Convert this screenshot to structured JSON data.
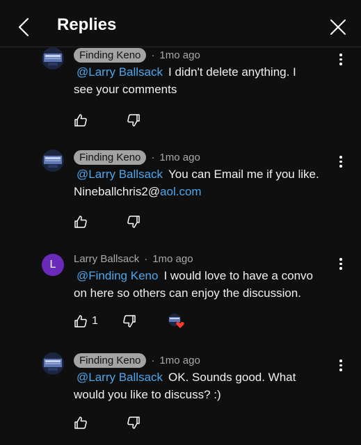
{
  "header": {
    "title": "Replies"
  },
  "comments": [
    {
      "author": "Finding Keno",
      "author_highlight": true,
      "time": "1mo ago",
      "mention": "@Larry Ballsack",
      "text_line1": "I didn't delete anything. I",
      "text_line2": "see your comments",
      "likes": ""
    },
    {
      "author": "Finding Keno",
      "author_highlight": true,
      "time": "1mo ago",
      "mention": "@Larry Ballsack",
      "text_line1": "You can Email me if you like.",
      "email_user": "Nineballchris2@",
      "email_domain": "aol.com",
      "likes": ""
    },
    {
      "author": "Larry Ballsack",
      "author_highlight": false,
      "avatar_letter": "L",
      "time": "1mo ago",
      "mention": "@Finding Keno",
      "text_line1": "I would love to have a convo",
      "text_line2": "on here so others can enjoy the discussion.",
      "likes": "1",
      "creator_heart": true
    },
    {
      "author": "Finding Keno",
      "author_highlight": true,
      "time": "1mo ago",
      "mention": "@Larry Ballsack",
      "text_line1": "OK. Sounds good. What",
      "text_line2": "would you like to discuss? :)",
      "likes": ""
    }
  ],
  "colors": {
    "background": "#0f0f0f",
    "link": "#4ea6ec",
    "chip": "#a3a3a3",
    "heart": "#ff3b30",
    "avatar_l": "#6a2bbb"
  }
}
